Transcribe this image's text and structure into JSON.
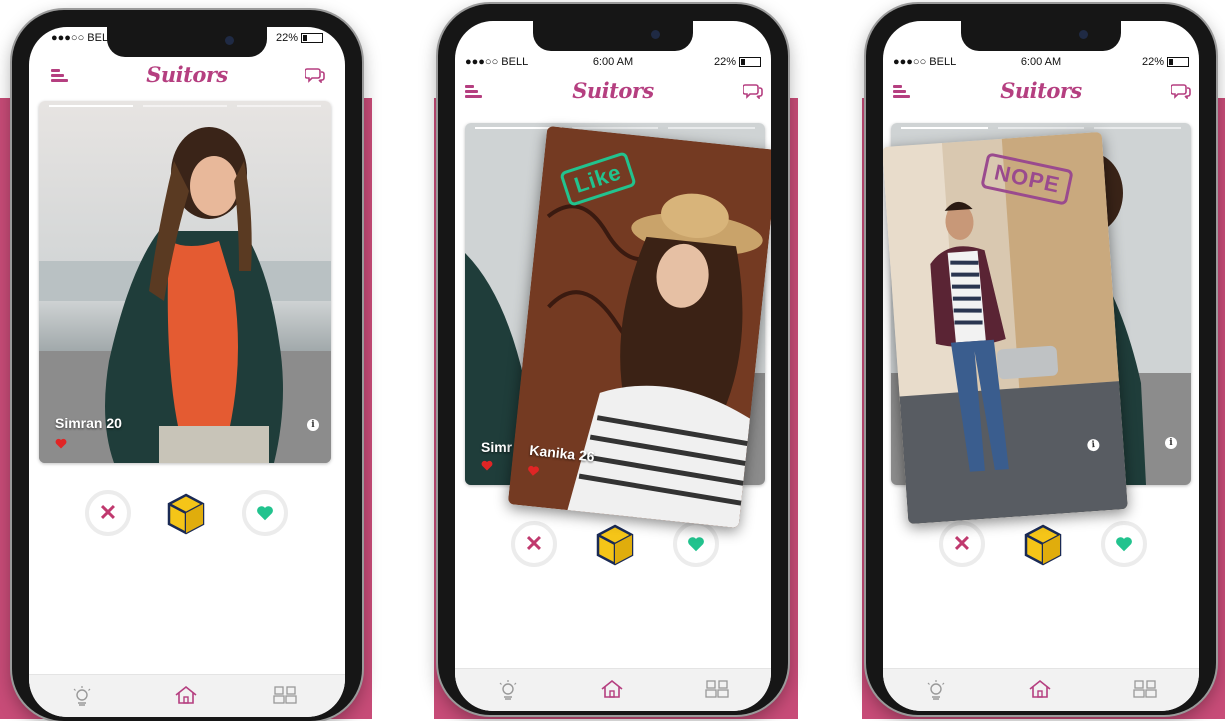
{
  "colors": {
    "brand": "#b53f80",
    "band": "#c84c78",
    "like": "#22c38e",
    "nope": "#9a4a8e",
    "heart_red": "#e02525"
  },
  "phones": [
    {
      "status": {
        "carrier": "●●●○○ BELL",
        "time": "",
        "battery": "22%"
      },
      "logo": "Suitors",
      "cards": [
        {
          "name": "Simran 20"
        }
      ]
    },
    {
      "status": {
        "carrier": "●●●○○ BELL",
        "time": "6:00 AM",
        "battery": "22%"
      },
      "logo": "Suitors",
      "cards": [
        {
          "name": "Simr"
        },
        {
          "name": "Kanika 26"
        }
      ],
      "stamp": "Like"
    },
    {
      "status": {
        "carrier": "●●●○○ BELL",
        "time": "6:00 AM",
        "battery": "22%"
      },
      "logo": "Suitors",
      "cards": [
        {
          "name": ""
        }
      ],
      "stamp": "NOPE"
    }
  ],
  "icons": {
    "menu": "menu-icon",
    "chat": "chat-bubbles-icon",
    "dislike": "close-icon",
    "boost": "cube-icon",
    "like": "heart-icon",
    "tab_explore": "lightbulb-icon",
    "tab_home": "home-icon",
    "tab_matches": "people-icon"
  }
}
